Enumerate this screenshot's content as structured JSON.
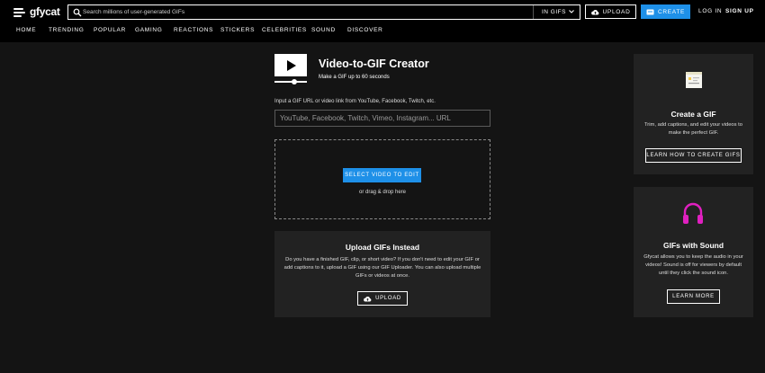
{
  "header": {
    "logo_text": "gfycat",
    "search": {
      "placeholder": "Search millions of user-generated GIFs",
      "value": ""
    },
    "scope_label": "IN GIFS",
    "upload_label": "UPLOAD",
    "create_label": "CREATE",
    "login_label": "LOG IN",
    "signup_label": "SIGN UP",
    "nav": [
      "HOME",
      "TRENDING",
      "POPULAR",
      "GAMING",
      "REACTIONS",
      "STICKERS",
      "CELEBRITIES",
      "SOUND",
      "DISCOVER"
    ]
  },
  "creator": {
    "title": "Video-to-GIF Creator",
    "subtitle": "Make a GIF up to 60 seconds",
    "url_label": "Input a GIF URL or video link from YouTube, Facebook, Twitch, etc.",
    "url_placeholder": "YouTube, Facebook, Twitch, Vimeo, Instagram... URL",
    "select_button": "SELECT VIDEO TO EDIT",
    "drag_text": "or drag & drop here"
  },
  "upload_card": {
    "title": "Upload GIFs Instead",
    "description": "Do you have a finished GIF, clip, or short video? If you don't need to edit your GIF or add captions to it, upload a GIF using our GIF Uploader. You can also upload multiple GIFs or videos at once.",
    "button": "UPLOAD"
  },
  "side_create": {
    "title": "Create a GIF",
    "description": "Trim, add captions, and edit your videos to make the perfect GIF.",
    "button": "LEARN HOW TO CREATE GIFS"
  },
  "side_sound": {
    "title": "GIFs with Sound",
    "description": "Gfycat allows you to keep the audio in your videos! Sound is off for viewers by default until they click the sound icon.",
    "button": "LEARN MORE"
  },
  "colors": {
    "accent": "#1e90e8",
    "background": "#141414",
    "card": "#222222",
    "headphones": "#e020c0"
  }
}
